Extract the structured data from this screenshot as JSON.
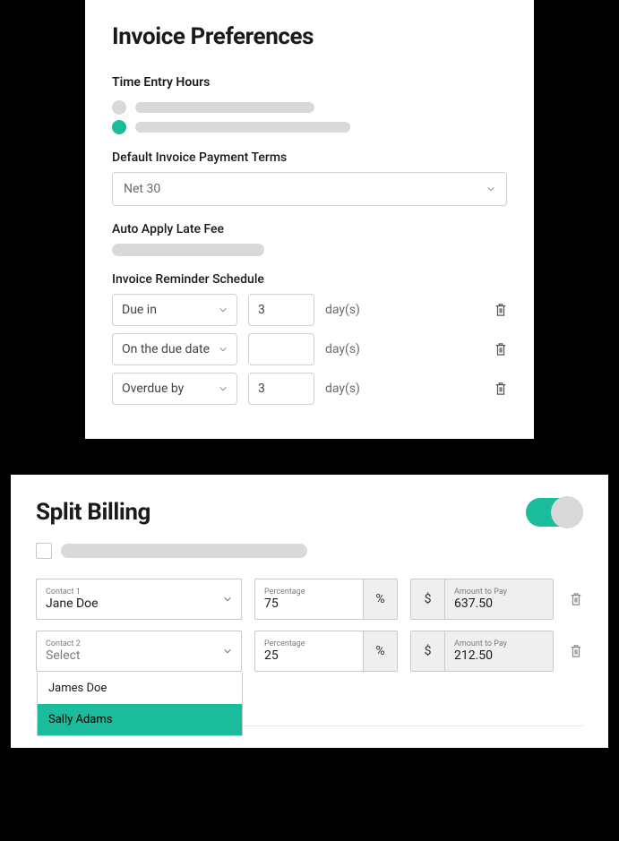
{
  "invoicePrefs": {
    "title": "Invoice Preferences",
    "timeEntry": {
      "label": "Time Entry Hours"
    },
    "paymentTerms": {
      "label": "Default Invoice Payment Terms",
      "value": "Net 30"
    },
    "lateFee": {
      "label": "Auto Apply Late Fee"
    },
    "reminder": {
      "label": "Invoice Reminder Schedule",
      "unit": "day(s)",
      "rows": [
        {
          "when": "Due in",
          "days": "3"
        },
        {
          "when": "On the due date",
          "days": ""
        },
        {
          "when": "Overdue by",
          "days": "3"
        }
      ]
    }
  },
  "splitBilling": {
    "title": "Split Billing",
    "toggleOn": true,
    "percentageLabel": "Percentage",
    "percentSymbol": "%",
    "amountLabel": "Amount to Pay",
    "currencySymbol": "$",
    "rows": [
      {
        "contactLabel": "Contact 1",
        "contactValue": "Jane Doe",
        "percentage": "75",
        "amount": "637.50"
      },
      {
        "contactLabel": "Contact 2",
        "contactValue": "Select",
        "percentage": "25",
        "amount": "212.50"
      }
    ],
    "dropdown": {
      "options": [
        "James Doe",
        "Sally Adams"
      ],
      "highlightedIndex": 1
    }
  }
}
